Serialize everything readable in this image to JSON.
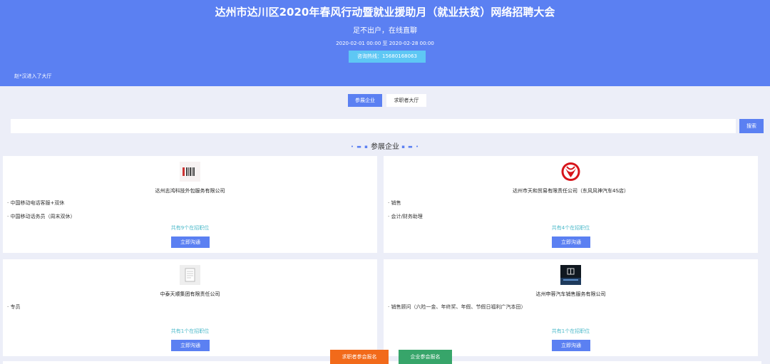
{
  "header": {
    "title": "达州市达川区2020年春风行动暨就业援助月（就业扶贫）网络招聘大会",
    "subtitle": "足不出户，在线直聊",
    "dates": "2020-02-01 00:00 至 2020-02-28 00:00",
    "hotline": "咨询热线：15680168063",
    "entered": "赵*汉进入了大厅"
  },
  "tabs": {
    "companies": "参展企业",
    "seekers": "求职者大厅"
  },
  "search": {
    "placeholder": "",
    "button": "搜索"
  },
  "section": {
    "title": "参展企业"
  },
  "cards": [
    {
      "company": "达州志鸿科技外包服务有限公司",
      "jobs": [
        "中国移动电话客服+双休",
        "中国移动话务员（周末双休）"
      ],
      "count": "共有9个在招职位",
      "button": "立即沟通",
      "logo": "striped-logo-icon"
    },
    {
      "company": "达州市天和贸易有限责任公司（东风风神汽车4S店）",
      "jobs": [
        "销售",
        "会计/财务助理"
      ],
      "count": "共有4个在招职位",
      "button": "立即沟通",
      "logo": "dongfeng-logo-icon"
    },
    {
      "company": "中泰天顺集团有限责任公司",
      "jobs": [
        "专员"
      ],
      "count": "共有1个在招职位",
      "button": "立即沟通",
      "logo": "document-placeholder-icon"
    },
    {
      "company": "达州申蓉汽车销售服务有限公司",
      "jobs": [
        "销售顾问（六险一金、年终奖、年假、节假日福利广汽本田）"
      ],
      "count": "共有1个在招职位",
      "button": "立即沟通",
      "logo": "car-showroom-logo-icon"
    }
  ],
  "footer": {
    "seeker_signup": "求职者参会报名",
    "company_signup": "企业参会报名"
  },
  "colors": {
    "header": "#5b80f2",
    "accent": "#5b80f2",
    "hotline": "#5ec7f4",
    "count": "#49b8c9",
    "seeker_button": "#f26a1a",
    "company_button": "#37a56a"
  }
}
